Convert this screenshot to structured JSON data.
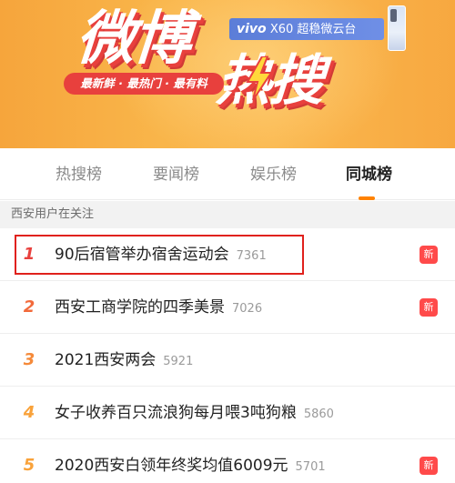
{
  "banner": {
    "title_main": "微博",
    "title_sub": "热搜",
    "slogan": "最新鲜 · 最热门 · 最有料",
    "sponsor_brand": "vivo",
    "sponsor_text": "X60 超稳微云台"
  },
  "tabs": [
    {
      "label": "热搜榜",
      "active": false
    },
    {
      "label": "要闻榜",
      "active": false
    },
    {
      "label": "娱乐榜",
      "active": false
    },
    {
      "label": "同城榜",
      "active": true
    }
  ],
  "section": {
    "title": "西安用户在关注"
  },
  "list": [
    {
      "rank": "1",
      "title": "90后宿管举办宿舍运动会",
      "count": "7361",
      "badge": "新",
      "rank_color": "#e8403d"
    },
    {
      "rank": "2",
      "title": "西安工商学院的四季美景",
      "count": "7026",
      "badge": "新",
      "rank_color": "#f26a3b"
    },
    {
      "rank": "3",
      "title": "2021西安两会",
      "count": "5921",
      "badge": "",
      "rank_color": "#f58a3a"
    },
    {
      "rank": "4",
      "title": "女子收养百只流浪狗每月喂3吨狗粮",
      "count": "5860",
      "badge": "",
      "rank_color": "#f9a23a"
    },
    {
      "rank": "5",
      "title": "2020西安白领年终奖均值6009元",
      "count": "5701",
      "badge": "新",
      "rank_color": "#f9a23a"
    }
  ],
  "colors": {
    "accent": "#ff8200",
    "new_badge": "#ff4a4a",
    "highlight": "#e0211c"
  }
}
